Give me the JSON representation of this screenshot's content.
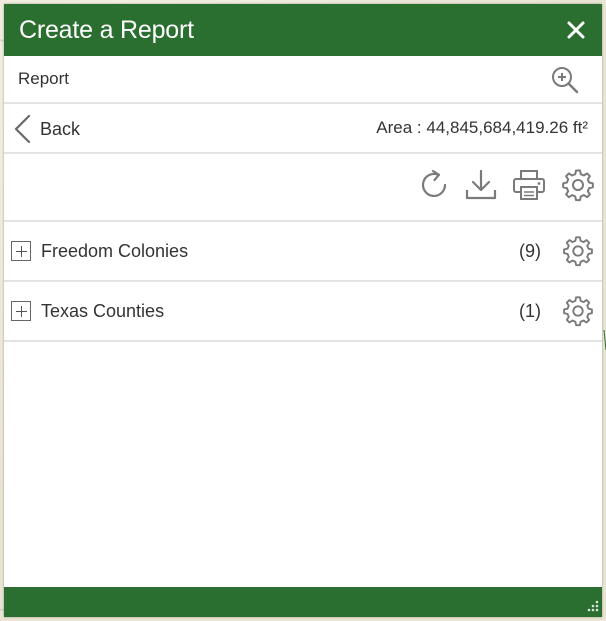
{
  "colors": {
    "header_green": "#2a6e30",
    "text": "#333333",
    "icon_gray": "#7a7a7a",
    "divider": "#e3e3e3"
  },
  "header": {
    "title": "Create a Report",
    "close_icon": "close-icon"
  },
  "search": {
    "placeholder": "Report",
    "icon": "zoom-in-icon"
  },
  "nav": {
    "back_label": "Back",
    "area_text": "Area : 44,845,684,419.26 ft²"
  },
  "toolbar": {
    "icons": [
      "refresh-icon",
      "download-icon",
      "print-icon",
      "settings-icon"
    ]
  },
  "layers": [
    {
      "name": "Freedom Colonies",
      "count": "(9)"
    },
    {
      "name": "Texas Counties",
      "count": "(1)"
    }
  ]
}
